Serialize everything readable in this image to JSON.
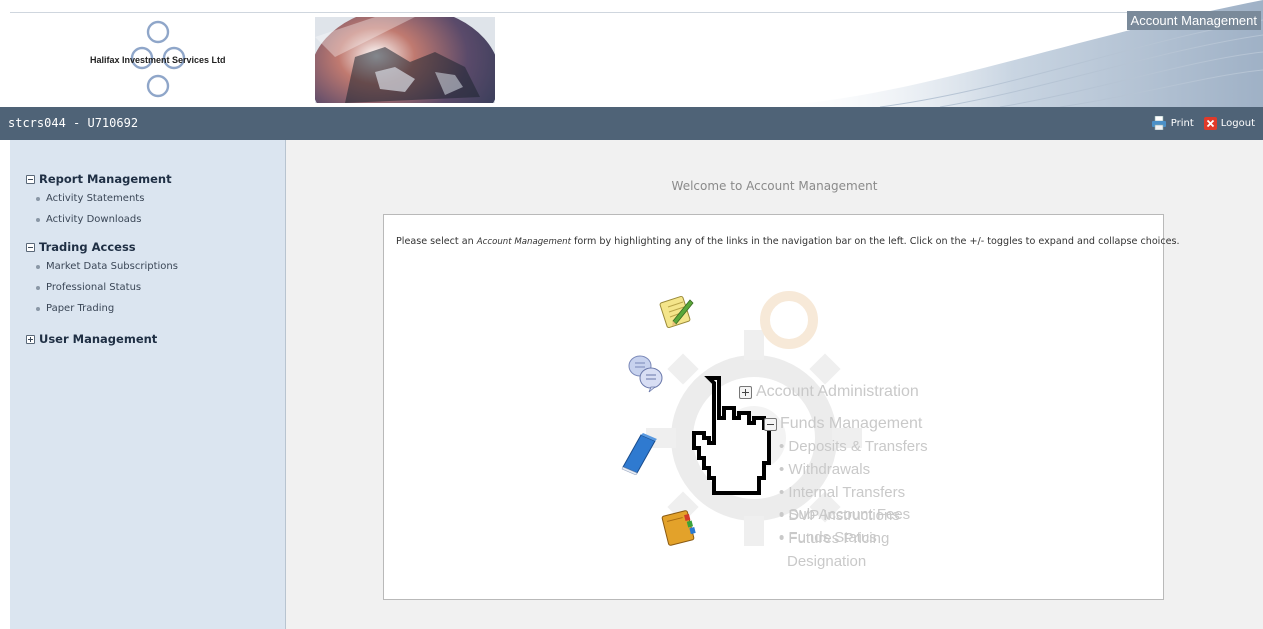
{
  "header": {
    "logo_text": "Halifax Investment Services Ltd",
    "app_title": "Account Management"
  },
  "userbar": {
    "user": "stcrs044 - U710692",
    "print_label": "Print",
    "logout_label": "Logout"
  },
  "sidebar": {
    "sections": [
      {
        "label": "Report Management",
        "expanded": true,
        "items": [
          "Activity Statements",
          "Activity Downloads"
        ]
      },
      {
        "label": "Trading Access",
        "expanded": true,
        "items": [
          "Market Data Subscriptions",
          "Professional Status",
          "Paper Trading"
        ]
      },
      {
        "label": "User Management",
        "expanded": false,
        "items": []
      }
    ]
  },
  "main": {
    "welcome": "Welcome to Account Management",
    "intro_before": "Please select an ",
    "intro_italic": "Account Management",
    "intro_after": " form by highlighting any of the links in the navigation bar on the left. Click on the +/- toggles to expand and collapse choices."
  },
  "illustration": {
    "account_admin": "Account Administration",
    "funds_mgmt": "Funds Management",
    "items": [
      "Deposits & Transfers",
      "Withdrawals",
      "Internal Transfers",
      "DVP Instructions",
      "Futures Pricing",
      "Designation",
      "Sub Account Fees",
      "Funds Status"
    ]
  },
  "colors": {
    "userbar": "#4f6377",
    "sidebar": "#dbe5f0",
    "main_bg": "#f1f1f1"
  },
  "icons": [
    "logo-knot-icon",
    "globe-image",
    "print-icon",
    "logout-icon",
    "notepad-icon",
    "speech-bubbles-icon",
    "book-icon",
    "address-book-icon",
    "pointer-hand-icon",
    "gear-icon"
  ]
}
